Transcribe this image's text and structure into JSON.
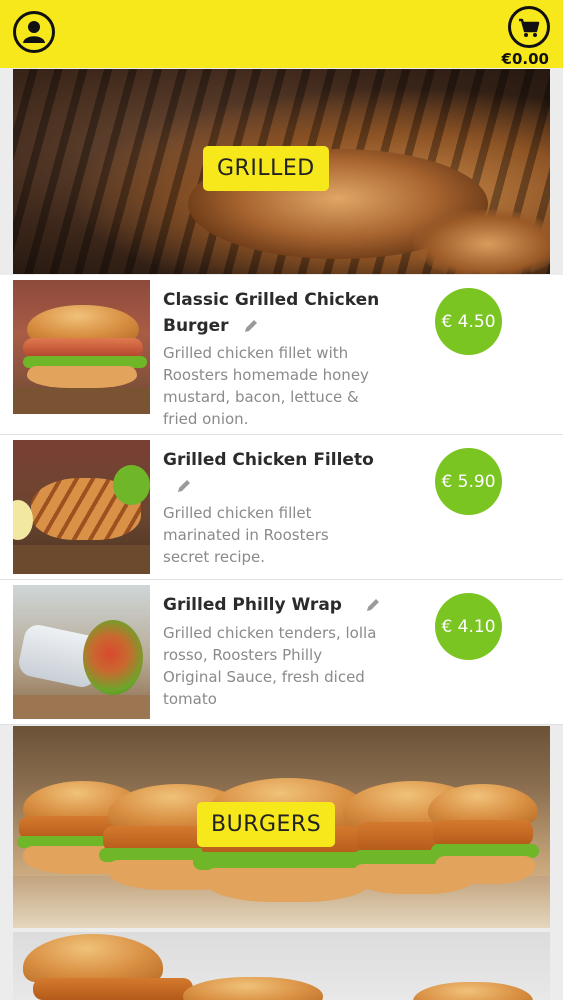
{
  "header": {
    "profile_icon": "user-icon",
    "cart_icon": "cart-icon",
    "cart_total": "€0.00",
    "accent_color": "#f7e81c"
  },
  "sections": [
    {
      "label": "GRILLED"
    },
    {
      "label": "BURGERS"
    }
  ],
  "items": [
    {
      "name": "Classic Grilled Chicken Burger",
      "description": "Grilled chicken fillet with Roosters homemade honey mustard, bacon, lettuce & fried onion.",
      "price": "€ 4.50",
      "edit_icon": "pencil-icon"
    },
    {
      "name": "Grilled Chicken Filleto",
      "description": "Grilled chicken fillet marinated in Roosters secret recipe.",
      "price": "€ 5.90",
      "edit_icon": "pencil-icon"
    },
    {
      "name": "Grilled Philly Wrap",
      "description": "Grilled chicken tenders, lolla rosso, Roosters Philly Original Sauce, fresh diced tomato",
      "price": "€ 4.10",
      "edit_icon": "pencil-icon"
    }
  ],
  "price_color": "#7ac522"
}
